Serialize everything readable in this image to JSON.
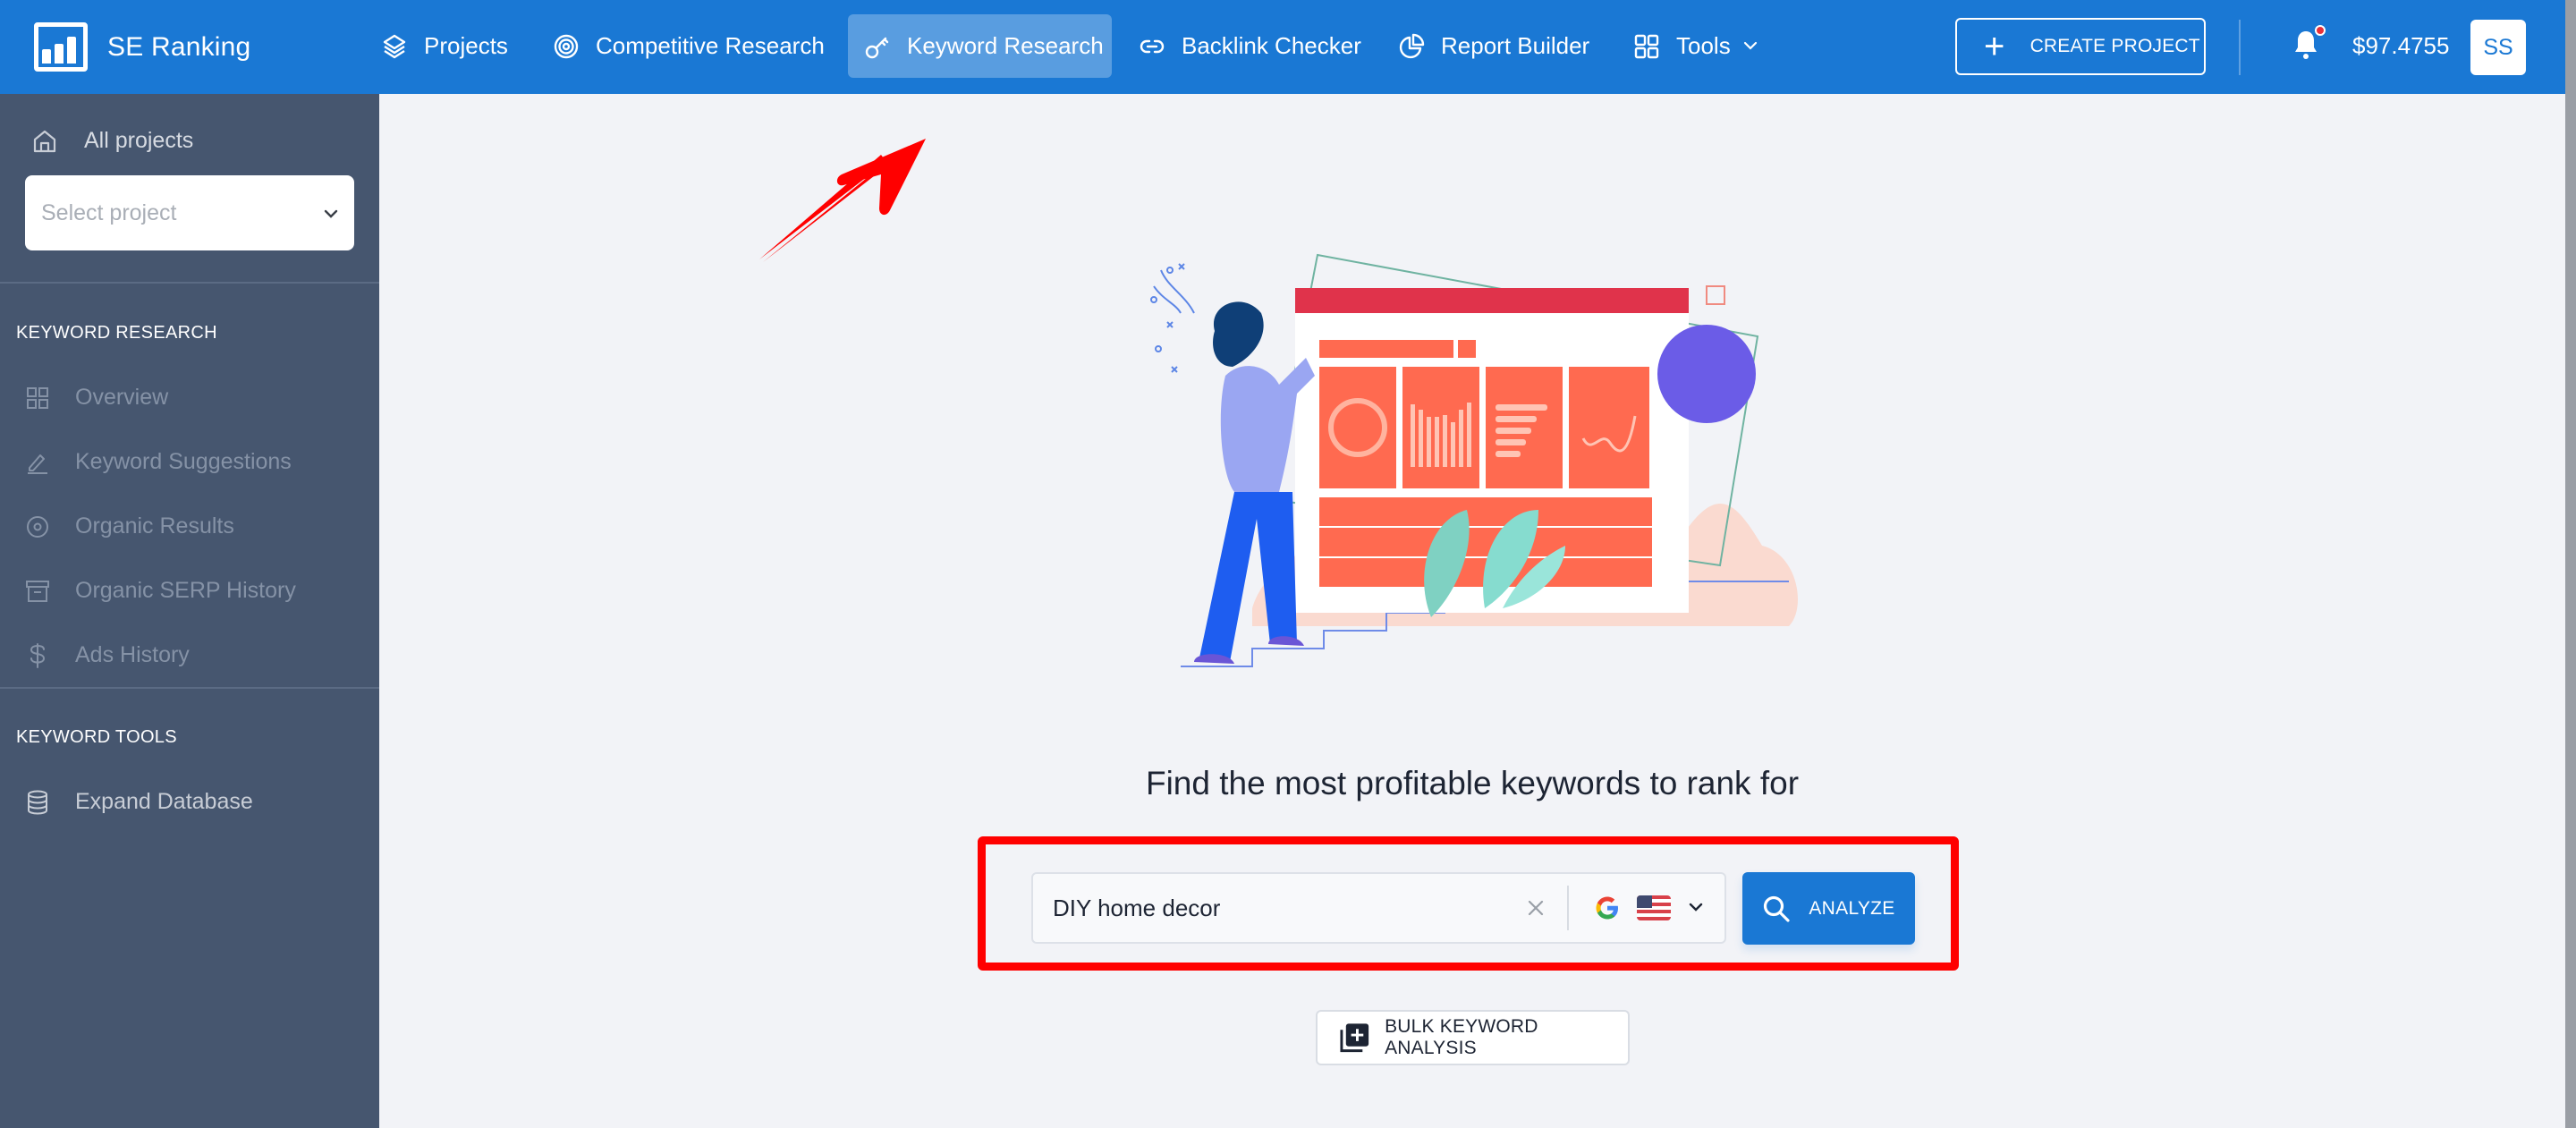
{
  "header": {
    "brand": "SE Ranking",
    "nav": [
      {
        "label": "Projects",
        "icon": "layers-icon",
        "active": false
      },
      {
        "label": "Competitive Research",
        "icon": "target-icon",
        "active": false
      },
      {
        "label": "Keyword Research",
        "icon": "key-icon",
        "active": true
      },
      {
        "label": "Backlink Checker",
        "icon": "link-icon",
        "active": false
      },
      {
        "label": "Report Builder",
        "icon": "pie-chart-icon",
        "active": false
      },
      {
        "label": "Tools",
        "icon": "grid-icon",
        "active": false,
        "has_dropdown": true
      }
    ],
    "create_project_label": "CREATE PROJECT",
    "balance": "$97.4755",
    "avatar_initials": "SS",
    "has_notification": true
  },
  "sidebar": {
    "all_projects_label": "All projects",
    "select_project_placeholder": "Select project",
    "sections": [
      {
        "heading": "KEYWORD RESEARCH",
        "items": [
          {
            "label": "Overview",
            "icon": "grid-icon",
            "enabled": false
          },
          {
            "label": "Keyword Suggestions",
            "icon": "pencil-icon",
            "enabled": false
          },
          {
            "label": "Organic Results",
            "icon": "target-icon",
            "enabled": false
          },
          {
            "label": "Organic SERP History",
            "icon": "archive-icon",
            "enabled": false
          },
          {
            "label": "Ads History",
            "icon": "dollar-icon",
            "enabled": false
          }
        ]
      },
      {
        "heading": "KEYWORD TOOLS",
        "items": [
          {
            "label": "Expand Database",
            "icon": "database-icon",
            "enabled": true
          }
        ]
      }
    ]
  },
  "main": {
    "headline": "Find the most profitable keywords to rank for",
    "search": {
      "value": "DIY home decor",
      "search_engine": "Google",
      "country": "United States"
    },
    "analyze_label": "ANALYZE",
    "bulk_label": "BULK KEYWORD ANALYSIS"
  },
  "annotations": {
    "arrow_color": "#ff0000",
    "highlight_color": "#ff0000"
  },
  "colors": {
    "brand_blue": "#1a78d4",
    "sidebar_bg": "#46566f",
    "page_bg": "#f2f3f7"
  }
}
